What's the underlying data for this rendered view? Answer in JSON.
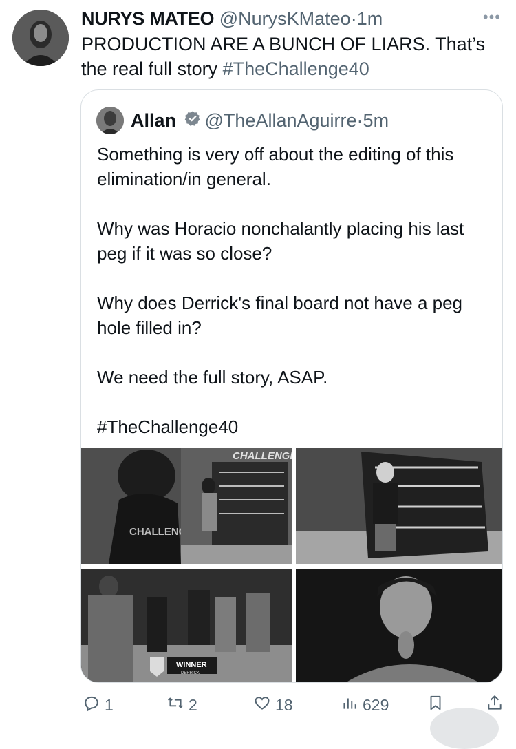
{
  "tweet": {
    "author_name": "NURYS MATEO",
    "author_handle": "@NurysKMateo",
    "separator": "·",
    "time": "1m",
    "more_label": "•••",
    "text_main": "PRODUCTION ARE A BUNCH OF LIARS. That’s the real full story ",
    "hashtag": "#TheChallenge40"
  },
  "quote": {
    "author_name": "Allan",
    "author_handle": "@TheAllanAguirre",
    "separator": "·",
    "time": "5m",
    "text": "Something is very off about the editing of this elimination/in general.\n\nWhy was Horacio nonchalantly placing his last peg if it was so close?\n\nWhy does Derrick's final board not have a peg hole filled in?\n\nWe need the full story, ASAP.\n\n#TheChallenge40",
    "media": {
      "tile1_label": "CHALLENGE",
      "tile1_shirt": "CHALLENG",
      "tile3_banner": "WINNER",
      "tile3_sub": "DERRICK"
    }
  },
  "actions": {
    "replies": "1",
    "reposts": "2",
    "likes": "18",
    "views": "629"
  },
  "colors": {
    "text": "#0f1419",
    "secondary": "#536471",
    "border": "#dadfe3"
  }
}
